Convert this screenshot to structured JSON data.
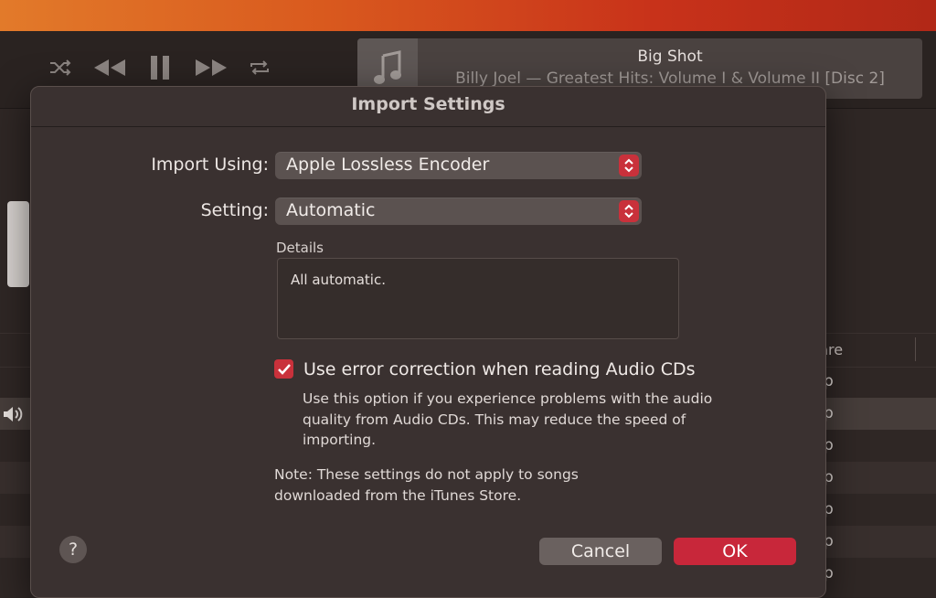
{
  "colors": {
    "accent": "#c8273a",
    "dialog_bg": "#3a3130",
    "popup_bg": "#5b5250"
  },
  "toolbar": {
    "shuffle_icon": "shuffle-icon",
    "prev_icon": "rewind-icon",
    "pause_icon": "pause-icon",
    "next_icon": "fast-forward-icon",
    "repeat_icon": "repeat-icon"
  },
  "now_playing": {
    "artwork_icon": "music-note-icon",
    "title": "Big Shot",
    "subtitle": "Billy Joel — Greatest Hits: Volume I & Volume II [Disc 2]"
  },
  "list": {
    "genre_header": "enre",
    "rows": [
      {
        "genre": "p"
      },
      {
        "genre": "p"
      },
      {
        "genre": "p"
      },
      {
        "genre": "p"
      },
      {
        "genre": "p"
      },
      {
        "genre": "p"
      },
      {
        "genre": "p"
      }
    ]
  },
  "dialog": {
    "title": "Import Settings",
    "import_using_label": "Import Using:",
    "import_using_value": "Apple Lossless Encoder",
    "setting_label": "Setting:",
    "setting_value": "Automatic",
    "details_label": "Details",
    "details_text": "All automatic.",
    "error_correction_label": "Use error correction when reading Audio CDs",
    "error_correction_checked": true,
    "error_correction_help": "Use this option if you experience problems with the audio quality from Audio CDs. This may reduce the speed of importing.",
    "note": "Note: These settings do not apply to songs downloaded from the iTunes Store.",
    "help_label": "?",
    "cancel_label": "Cancel",
    "ok_label": "OK"
  }
}
